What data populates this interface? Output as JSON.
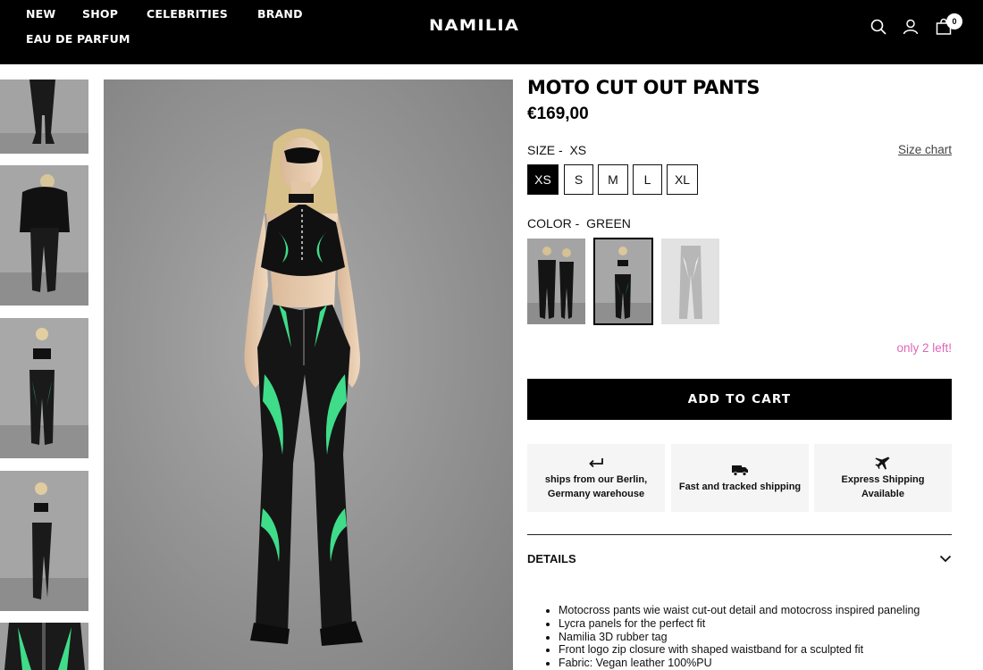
{
  "header": {
    "nav": [
      "NEW",
      "SHOP",
      "CELEBRITIES",
      "BRAND",
      "EAU DE PARFUM"
    ],
    "logo": "NAMILIA",
    "cart_count": "0",
    "icons": [
      "search-icon",
      "account-icon",
      "cart-icon"
    ]
  },
  "product": {
    "title": "MOTO CUT OUT PANTS",
    "price": "€169,00",
    "size_label": "SIZE -",
    "selected_size": "XS",
    "size_chart": "Size chart",
    "sizes": [
      "XS",
      "S",
      "M",
      "L",
      "XL"
    ],
    "color_label": "COLOR -",
    "selected_color": "GREEN",
    "stock": "only 2 left!",
    "add_to_cart": "ADD TO CART",
    "features": [
      {
        "icon": "return-arrow-icon",
        "text": "ships from our Berlin, Germany warehouse"
      },
      {
        "icon": "truck-icon",
        "text": "Fast and tracked shipping"
      },
      {
        "icon": "airplane-icon",
        "text": "Express Shipping Available"
      }
    ],
    "details_label": "DETAILS",
    "details": [
      "Motocross pants wie waist cut-out detail and motocross inspired paneling",
      "Lycra panels for the perfect fit",
      "Namilia 3D rubber tag",
      "Front logo zip closure with shaped waistband for a sculpted fit",
      "Fabric: Vegan leather 100%PU"
    ]
  },
  "colors": {
    "accent_green": "#3fdc8a",
    "stock_pink": "#e066b8"
  }
}
